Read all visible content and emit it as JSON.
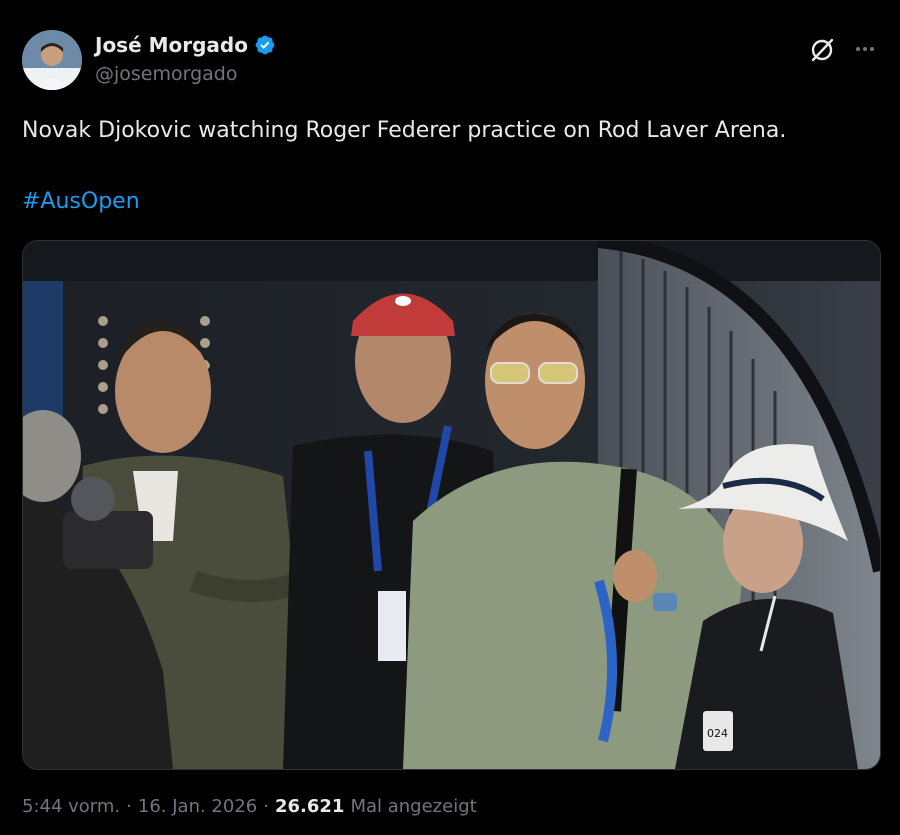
{
  "author": {
    "name": "José Morgado",
    "handle": "@josemorgado",
    "verified": true,
    "verified_color": "#1d9bf0"
  },
  "tweet": {
    "text": "Novak Djokovic watching Roger Federer practice on Rod Laver Arena.",
    "hashtag": "#AusOpen",
    "hashtag_color": "#1d9bf0"
  },
  "media": {
    "type": "photo",
    "badges": {
      "cap_logo": "red-cap-logo",
      "credential_number": "024"
    }
  },
  "meta": {
    "time": "5:44 vorm.",
    "separator": "·",
    "date": "16. Jan. 2026",
    "views": "26.621",
    "views_label": "Mal angezeigt"
  },
  "icons": {
    "grok": "grok-icon",
    "more": "more-icon",
    "verified": "verified-badge-icon"
  }
}
